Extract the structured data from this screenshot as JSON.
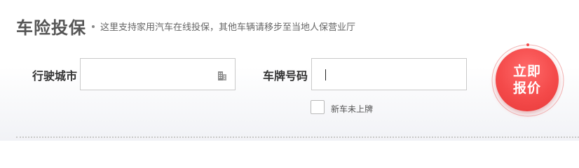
{
  "header": {
    "title": "车险投保",
    "subtitle": "这里支持家用汽车在线投保，其他车辆请移步至当地人保营业厅"
  },
  "form": {
    "city_label": "行驶城市",
    "city_value": "",
    "plate_label": "车牌号码",
    "plate_value": "",
    "new_car_checkbox_label": "新车未上牌",
    "new_car_checked": false
  },
  "quote_button": {
    "label": "立即报价"
  },
  "icons": {
    "city_picker": "building-icon"
  },
  "colors": {
    "accent": "#f44a4a",
    "ring": "#f0a0a0"
  }
}
